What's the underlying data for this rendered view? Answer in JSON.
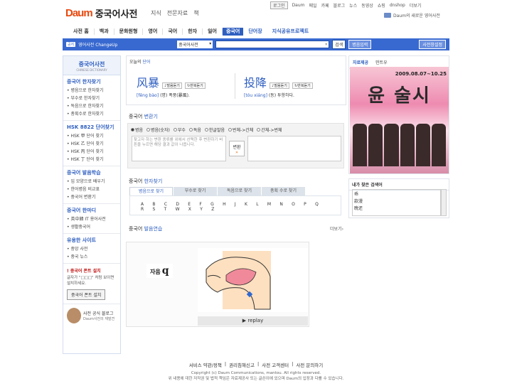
{
  "header": {
    "logo": "Daum",
    "service": "중국어사전",
    "nav": [
      "지식",
      "전문자료",
      "책"
    ],
    "util": [
      "로그인",
      "Daum",
      "메일",
      "카페",
      "블로그",
      "뉴스",
      "동영상",
      "쇼핑",
      "dnshop",
      "더보기"
    ],
    "promo": "Daum의 새로운 영어사전"
  },
  "gnb": {
    "items": [
      "사전 홈",
      "백과",
      "문화원형",
      "영어",
      "국어",
      "한자",
      "일어",
      "중국어",
      "단어장",
      "지식공유프로젝트"
    ],
    "active": "중국어"
  },
  "searchbar": {
    "notice_tag": "공지",
    "notice": "영어사전 ChangeUp",
    "select": "중국어사전",
    "input_value": "",
    "search_button": "검색",
    "ime_button": "병음입력",
    "settings_button": "사전창설정"
  },
  "sidebar": {
    "title": "중국어사전",
    "subtitle": "CHINESE DICTIONARY",
    "sections": [
      {
        "title": "중국어 한자찾기",
        "items": [
          "병음으로 한자찾기",
          "부수로 한자찾기",
          "독음으로 한자찾기",
          "총획수로 한자찾기"
        ]
      },
      {
        "title": "HSK 8822 단어찾기",
        "items": [
          "HSK 甲 단어 찾기",
          "HSK 乙 단어 찾기",
          "HSK 丙 단어 찾기",
          "HSK 丁 단어 찾기"
        ]
      },
      {
        "title": "중국어 발음학습",
        "items": [
          "입 모양으로 배우기",
          "한어병음 비교표",
          "중국어 변환기"
        ]
      },
      {
        "title": "중국어 한마디",
        "items": [
          "英中韓 IT 용어사전",
          "생활중국어"
        ]
      },
      {
        "title": "유용한 사이트",
        "items": [
          "중앙 사전",
          "중국 뉴스"
        ]
      }
    ],
    "font": {
      "title": "중국어 폰트 설치",
      "desc": "글자가 \"□□□\" 처럼 보이면 설치하세요.",
      "button": "중국어 폰트 설치"
    },
    "blog": {
      "title": "사전 공식 블로그",
      "sub": "Daum사전의 재발견"
    }
  },
  "word_of_day": {
    "heading_prefix": "오늘의",
    "heading": "단어",
    "entries": [
      {
        "hanzi": "风暴",
        "pinyin": "[fēng bào]",
        "meaning": "(명) 폭풍(暴風).",
        "listen": "발음듣기",
        "repeat": "반복듣기"
      },
      {
        "hanzi": "投降",
        "pinyin": "[tóu xiáng]",
        "meaning": "(동) 투항하다.",
        "listen": "발음듣기",
        "repeat": "반복듣기"
      }
    ]
  },
  "converter": {
    "heading_prefix": "중국어",
    "heading": "변환기",
    "options": [
      "병음",
      "병음(숫자)",
      "부수",
      "독음",
      "한글발음",
      "번체->간체",
      "간체->번체"
    ],
    "selected": "병음",
    "placeholder": "찾고자 하는 변환 종류를 위에서 선택한 후 변환하기 버튼을 누르면 해당 결과 값이 나옵니다.",
    "button": "변환",
    "button_arrow": "»"
  },
  "hanzi_search": {
    "heading_prefix": "중국어",
    "heading": "한자찾기",
    "tabs": [
      "병음으로 찾기",
      "부수로 찾기",
      "독음으로 찾기",
      "총획 수로 찾기"
    ],
    "active_tab": "병음으로 찾기",
    "letters": "A B C D E F G H J K L M N O P Q R S T W X Y Z"
  },
  "pronunciation": {
    "heading_prefix": "중국어",
    "heading": "발음연습",
    "more": "더보기",
    "label": "자음",
    "letter": "q",
    "play": "replay"
  },
  "right_banner": {
    "tabs": [
      "자료제공",
      "민트우"
    ],
    "date": "2009.08.07~10.25",
    "headline": "윤 술시"
  },
  "found_words": {
    "title": "내가 찾은 검색어",
    "items": [
      "乖",
      "款漫",
      "晚还"
    ]
  },
  "footer": {
    "links": [
      "서비스 약관/정책",
      "권리침해신고",
      "사전 고객센터",
      "사전 문의하기"
    ],
    "copyright": "Copyright (c) Daum Communications, mantou. All rights reserved.",
    "notice": "위 내용에 대한 저작권 및 법적 책임은 자료제공사 또는 글쓴이에 있으며 Daum의 입장과 다를 수 있습니다."
  },
  "colors": {
    "accent": "#2f5fc0",
    "searchbar": "#3869d0",
    "brand_orange": "#e8490f"
  }
}
